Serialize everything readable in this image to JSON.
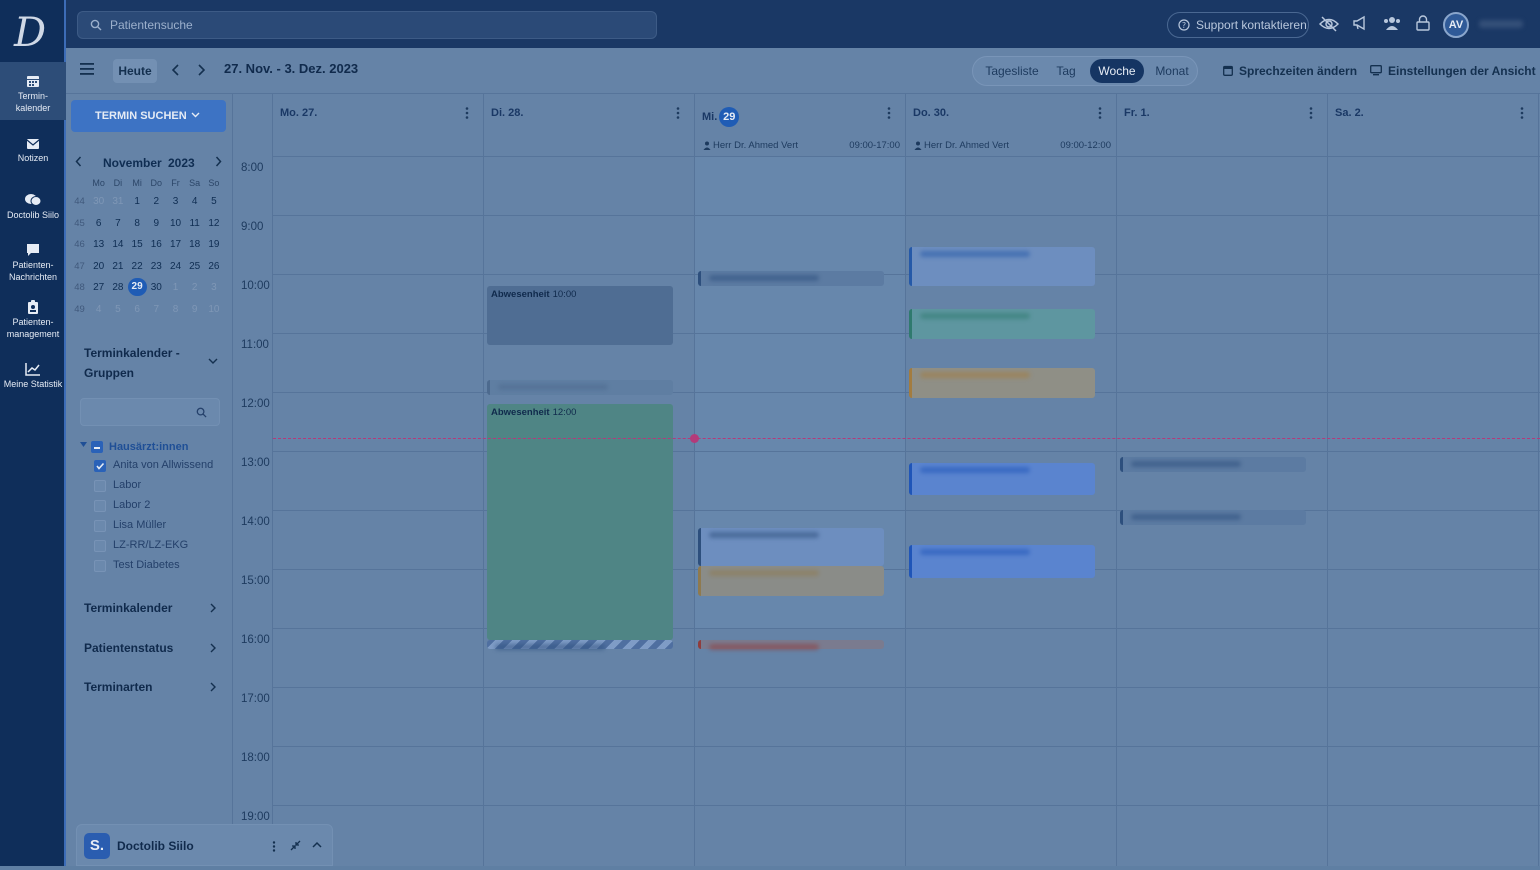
{
  "nav": {
    "logo": "D",
    "items": [
      {
        "l1": "Termin-",
        "l2": "kalender",
        "icon": "calendar-icon"
      },
      {
        "l1": "Notizen",
        "l2": "",
        "icon": "mail-icon"
      },
      {
        "l1": "Doctolib Siilo",
        "l2": "",
        "icon": "chat-icon"
      },
      {
        "l1": "Patienten-",
        "l2": "Nachrichten",
        "icon": "message-icon"
      },
      {
        "l1": "Patienten-",
        "l2": "management",
        "icon": "clipboard-icon"
      },
      {
        "l1": "Meine Statistik",
        "l2": "",
        "icon": "chart-icon"
      }
    ]
  },
  "topbar": {
    "search_placeholder": "Patientensuche",
    "support": "Support kontaktieren",
    "avatar": "AV"
  },
  "toolbar": {
    "today": "Heute",
    "range": "27. Nov. - 3. Dez. 2023",
    "views": [
      "Tagesliste",
      "Tag",
      "Woche",
      "Monat"
    ],
    "active_view": "Woche",
    "sprechzeiten": "Sprechzeiten ändern",
    "einstellungen": "Einstellungen der Ansicht"
  },
  "sidebar": {
    "search_btn": "TERMIN SUCHEN",
    "mini_cal": {
      "month": "November",
      "year": "2023",
      "dow": [
        "Mo",
        "Di",
        "Mi",
        "Do",
        "Fr",
        "Sa",
        "So"
      ],
      "weeks": [
        {
          "wk": "44",
          "days": [
            "30",
            "31",
            "1",
            "2",
            "3",
            "4",
            "5"
          ]
        },
        {
          "wk": "45",
          "days": [
            "6",
            "7",
            "8",
            "9",
            "10",
            "11",
            "12"
          ]
        },
        {
          "wk": "46",
          "days": [
            "13",
            "14",
            "15",
            "16",
            "17",
            "18",
            "19"
          ]
        },
        {
          "wk": "47",
          "days": [
            "20",
            "21",
            "22",
            "23",
            "24",
            "25",
            "26"
          ]
        },
        {
          "wk": "48",
          "days": [
            "27",
            "28",
            "29",
            "30",
            "1",
            "2",
            "3"
          ]
        },
        {
          "wk": "49",
          "days": [
            "4",
            "5",
            "6",
            "7",
            "8",
            "9",
            "10"
          ]
        }
      ],
      "today": "29"
    },
    "groups_title_1": "Terminkalender -",
    "groups_title_2": "Gruppen",
    "group": {
      "name": "Hausärzt:innen",
      "members": [
        {
          "label": "Anita von Allwissend",
          "checked": true
        },
        {
          "label": "Labor",
          "checked": false
        },
        {
          "label": "Labor 2",
          "checked": false
        },
        {
          "label": "Lisa Müller",
          "checked": false
        },
        {
          "label": "LZ-RR/LZ-EKG",
          "checked": false
        },
        {
          "label": "Test Diabetes",
          "checked": false
        }
      ]
    },
    "sections": [
      "Terminkalender",
      "Patientenstatus",
      "Terminarten"
    ]
  },
  "calendar": {
    "days": [
      {
        "label": "Mo. 27.",
        "today": false
      },
      {
        "label": "Di. 28.",
        "today": false
      },
      {
        "label": "Mi.",
        "badge": "29",
        "today": true
      },
      {
        "label": "Do. 30.",
        "today": false
      },
      {
        "label": "Fr. 1.",
        "today": false
      },
      {
        "label": "Sa. 2.",
        "today": false
      }
    ],
    "hours": [
      "8:00",
      "9:00",
      "10:00",
      "11:00",
      "12:00",
      "13:00",
      "14:00",
      "15:00",
      "16:00",
      "17:00",
      "18:00",
      "19:00"
    ],
    "shifts": [
      {
        "day": 2,
        "name": "Herr Dr. Ahmed Vert",
        "time": "09:00-17:00"
      },
      {
        "day": 3,
        "name": "Herr Dr. Ahmed Vert",
        "time": "09:00-12:00"
      }
    ],
    "events": [
      {
        "day": 1,
        "start": 10.0,
        "end": 11.0,
        "title": "Abwesenheit",
        "time": "10:00",
        "color": "#4f6d93",
        "bar": ""
      },
      {
        "day": 1,
        "start": 11.6,
        "end": 11.85,
        "title": "",
        "time": "",
        "color": "#5f7ea2",
        "bar": "#4d6a8e"
      },
      {
        "day": 1,
        "start": 12.0,
        "end": 16.0,
        "title": "Abwesenheit",
        "time": "12:00",
        "color": "#4f8585",
        "bar": ""
      },
      {
        "day": 1,
        "start": 16.0,
        "end": 16.15,
        "title": "",
        "time": "",
        "color": "#4f6fa0",
        "bar": ""
      },
      {
        "day": 2,
        "start": 9.75,
        "end": 10.0,
        "title": "",
        "time": "",
        "color": "#5c7ba2",
        "bar": "#2d4f7d"
      },
      {
        "day": 2,
        "start": 14.1,
        "end": 14.75,
        "title": "",
        "time": "",
        "color": "#6d8ebf",
        "bar": "#2d4f7d"
      },
      {
        "day": 2,
        "start": 14.75,
        "end": 15.25,
        "title": "",
        "time": "",
        "color": "#8a8c88",
        "bar": "#8f7a4f"
      },
      {
        "day": 2,
        "start": 16.0,
        "end": 16.15,
        "title": "",
        "time": "",
        "color": "#7a7b8f",
        "bar": "#8f3d3d"
      },
      {
        "day": 3,
        "start": 9.35,
        "end": 10.0,
        "title": "",
        "time": "",
        "color": "#6d8ebf",
        "bar": "#2559a8"
      },
      {
        "day": 3,
        "start": 10.4,
        "end": 10.9,
        "title": "",
        "time": "",
        "color": "#5e96a0",
        "bar": "#2f7a6e"
      },
      {
        "day": 3,
        "start": 11.4,
        "end": 11.9,
        "title": "",
        "time": "",
        "color": "#8f8f86",
        "bar": "#a37c3f"
      },
      {
        "day": 3,
        "start": 13.0,
        "end": 13.55,
        "title": "",
        "time": "",
        "color": "#5a84cf",
        "bar": "#1f55b8"
      },
      {
        "day": 3,
        "start": 14.4,
        "end": 14.95,
        "title": "",
        "time": "",
        "color": "#5a84cf",
        "bar": "#1f55b8"
      },
      {
        "day": 4,
        "start": 12.9,
        "end": 13.15,
        "title": "",
        "time": "",
        "color": "#5c7ba2",
        "bar": "#2d4f7d"
      },
      {
        "day": 4,
        "start": 13.8,
        "end": 14.05,
        "title": "",
        "time": "",
        "color": "#5c7ba2",
        "bar": "#2d4f7d"
      }
    ]
  },
  "silo": {
    "badge": "S.",
    "title": "Doctolib Siilo"
  }
}
